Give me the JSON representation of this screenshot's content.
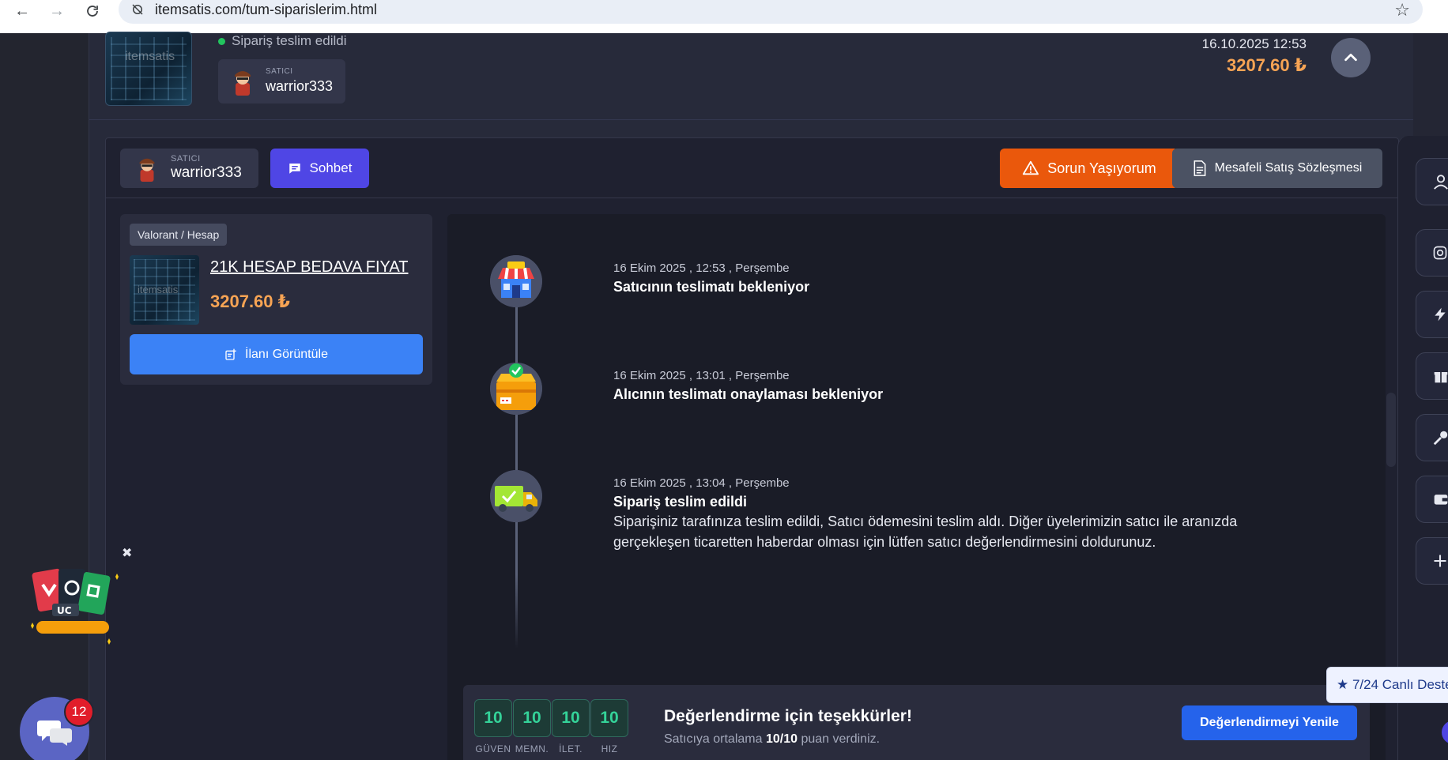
{
  "browser": {
    "url": "itemsatis.com/tum-siparislerim.html"
  },
  "order": {
    "status": "Sipariş teslim edildi",
    "seller_role": "SATICI",
    "seller_name": "warrior333",
    "date": "16.10.2025 12:53",
    "price": "3207.60 ₺",
    "thumb_watermark": "itemsatis"
  },
  "detail": {
    "seller_role": "SATICI",
    "seller_name": "warrior333",
    "chat_label": "Sohbet",
    "problem_label": "Sorun Yaşıyorum",
    "contract_label": "Mesafeli Satış Sözleşmesi"
  },
  "product": {
    "category": "Valorant / Hesap",
    "title": "21K HESAP BEDAVA FIYAT",
    "price": "3207.60 ₺",
    "view_label": "İlanı Görüntüle",
    "thumb_watermark": "itemsatis"
  },
  "timeline": [
    {
      "date": "16 Ekim 2025 , 12:53 , Perşembe",
      "title": "Satıcının teslimatı bekleniyor",
      "icon": "store-icon"
    },
    {
      "date": "16 Ekim 2025 , 13:01 , Perşembe",
      "title": "Alıcının teslimatı onaylaması bekleniyor",
      "icon": "box-check-icon"
    },
    {
      "date": "16 Ekim 2025 , 13:04 , Perşembe",
      "title": "Sipariş teslim edildi",
      "description": "Siparişiniz tarafınıza teslim edildi, Satıcı ödemesini teslim aldı. Diğer üyelerimizin satıcı ile aranızda gerçekleşen ticaretten haberdar olması için lütfen satıcı değerlendirmesini doldurunuz.",
      "icon": "truck-check-icon"
    }
  ],
  "rating": {
    "scores": [
      {
        "value": "10",
        "label": "GÜVEN"
      },
      {
        "value": "10",
        "label": "MEMN."
      },
      {
        "value": "10",
        "label": "İLET."
      },
      {
        "value": "10",
        "label": "HIZ"
      }
    ],
    "title": "Değerlendirme için teşekkürler!",
    "sub_before": "Satıcıya ortalama ",
    "sub_score": "10/10",
    "sub_after": " puan verdiniz.",
    "renew_label": "Değerlendirmeyi Yenile"
  },
  "side_tools": [
    "user-icon",
    "instagram-icon",
    "bolt-icon",
    "gift-icon",
    "key-icon",
    "wallet-icon",
    "plus-icon"
  ],
  "live_support": "★ 7/24 Canlı Deste",
  "chat_fab": {
    "badge": "12"
  },
  "colors": {
    "accent_orange": "#f7a454",
    "primary_blue": "#3b82f6",
    "indigo": "#4f46e5",
    "danger_orange": "#ea580c",
    "score_green": "#34d399"
  }
}
